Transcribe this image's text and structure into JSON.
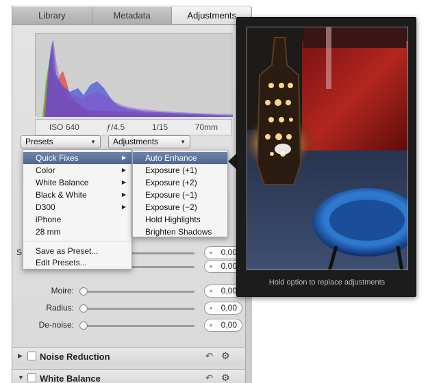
{
  "tabs": [
    {
      "label": "Library"
    },
    {
      "label": "Metadata"
    },
    {
      "label": "Adjustments",
      "active": true
    }
  ],
  "exif": {
    "iso": "ISO 640",
    "aperture": "ƒ/4.5",
    "shutter": "1/15",
    "focal": "70mm"
  },
  "toolbar": {
    "presets_label": "Presets",
    "adjustments_label": "Adjustments"
  },
  "preset_menu": {
    "items": [
      "Quick Fixes",
      "Color",
      "White Balance",
      "Black & White",
      "D300",
      "iPhone",
      "28 mm"
    ],
    "actions": [
      "Save as Preset...",
      "Edit Presets..."
    ],
    "highlighted": "Quick Fixes"
  },
  "quick_fixes_menu": {
    "items": [
      "Auto Enhance",
      "Exposure (+1)",
      "Exposure (+2)",
      "Exposure (−1)",
      "Exposure (−2)",
      "Hold Highlights",
      "Brighten Shadows"
    ],
    "highlighted": "Auto Enhance"
  },
  "sliders": [
    {
      "label": "",
      "value": "0,00"
    },
    {
      "label": "",
      "value": "0,00"
    },
    {
      "label": "Moire:",
      "value": "0,00"
    },
    {
      "label": "Radius:",
      "value": "0,00"
    },
    {
      "label": "De-noise:",
      "value": "0,00"
    }
  ],
  "bricks": {
    "noise_reduction": "Noise Reduction",
    "white_balance": "White Balance"
  },
  "hud": {
    "hint": "Hold option to replace adjustments"
  },
  "partial_labels": {
    "s": "S"
  },
  "icons": {
    "submenu_arrow": "▶",
    "popup_arrow": "▼",
    "gear": "⚙",
    "undo": "↶",
    "collapsed": "▶",
    "expanded": "▼"
  },
  "colors": {
    "highlight": "#5a729b",
    "hud_bg": "#1c1c1c"
  }
}
